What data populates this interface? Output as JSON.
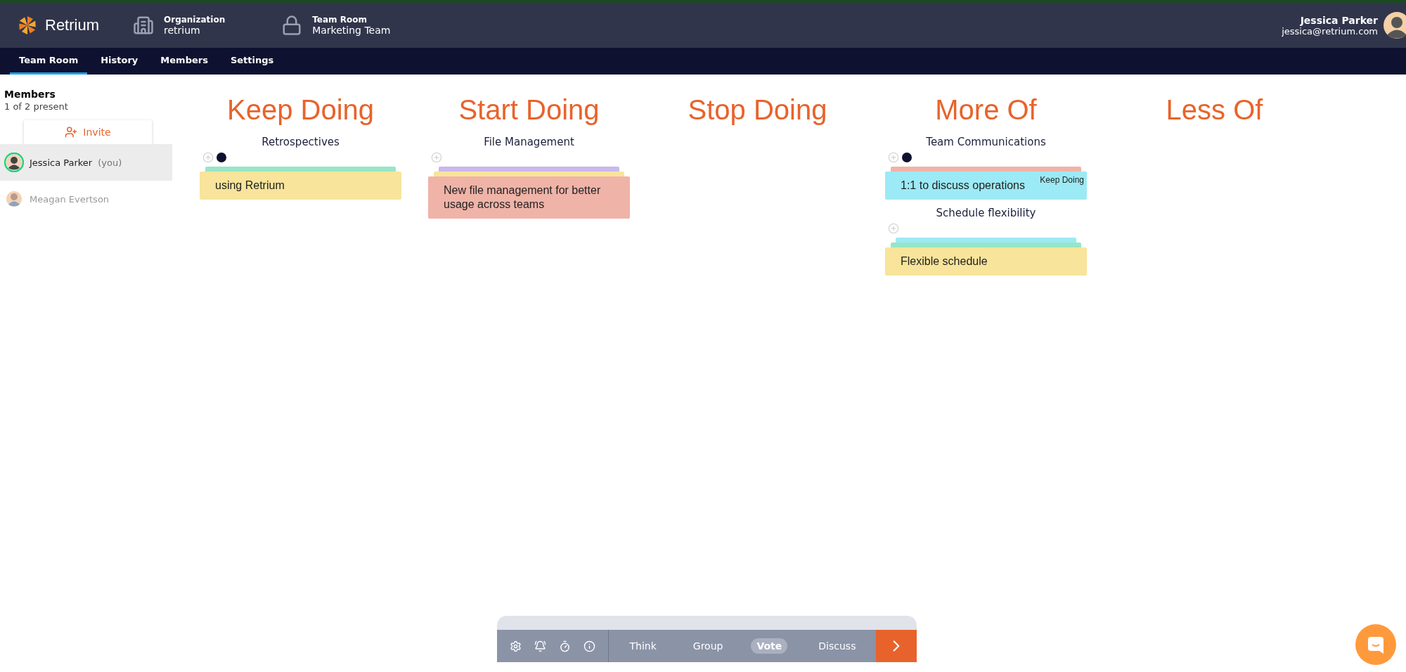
{
  "header": {
    "logo": "Retrium",
    "organization": {
      "label": "Organization",
      "value": "retrium"
    },
    "team_room": {
      "label": "Team Room",
      "value": "Marketing Team"
    },
    "user": {
      "name": "Jessica Parker",
      "email": "jessica@retrium.com"
    }
  },
  "nav_tabs": [
    {
      "label": "Team Room",
      "selected": true
    },
    {
      "label": "History",
      "selected": false
    },
    {
      "label": "Members",
      "selected": false
    },
    {
      "label": "Settings",
      "selected": false
    }
  ],
  "sidebar": {
    "title": "Members",
    "count": "1 of 2 present",
    "invite": "Invite",
    "members": [
      {
        "name": "Jessica Parker",
        "suffix": "(you)",
        "present": true,
        "selected": true
      },
      {
        "name": "Meagan Evertson",
        "present": false,
        "selected": false
      }
    ]
  },
  "columns": [
    {
      "title": "Keep Doing",
      "groups": [
        {
          "title": "Retrospectives",
          "voted": true,
          "stacked": [
            {
              "color": "#97e6c6"
            }
          ],
          "card": {
            "text": "using Retrium",
            "color": "#f8e49a"
          }
        }
      ]
    },
    {
      "title": "Start Doing",
      "groups": [
        {
          "title": "File Management",
          "voted": false,
          "stacked": [
            {
              "color": "#c9b8ee"
            },
            {
              "color": "#f8e49a"
            }
          ],
          "card": {
            "text": "New file management for better usage across teams",
            "color": "#f0b3a8"
          }
        }
      ]
    },
    {
      "title": "Stop Doing"
    },
    {
      "title": "More Of",
      "groups": [
        {
          "title": "Team Communications",
          "voted": true,
          "stacked": [
            {
              "color": "#f0b3a8"
            }
          ],
          "card": {
            "text": "1:1 to discuss operations",
            "color": "#9ceaf5",
            "tag": "Keep Doing"
          }
        },
        {
          "title": "Schedule flexibility",
          "voted": false,
          "stacked": [
            {
              "color": "#9ceaf5"
            },
            {
              "color": "#97e6c6"
            }
          ],
          "card": {
            "text": "Flexible schedule",
            "color": "#f8e49a"
          }
        }
      ]
    },
    {
      "title": "Less Of"
    }
  ],
  "toolbar": {
    "phases": [
      {
        "label": "Think",
        "selected": false
      },
      {
        "label": "Group",
        "selected": false
      },
      {
        "label": "Vote",
        "selected": true
      },
      {
        "label": "Discuss",
        "selected": false
      }
    ]
  }
}
